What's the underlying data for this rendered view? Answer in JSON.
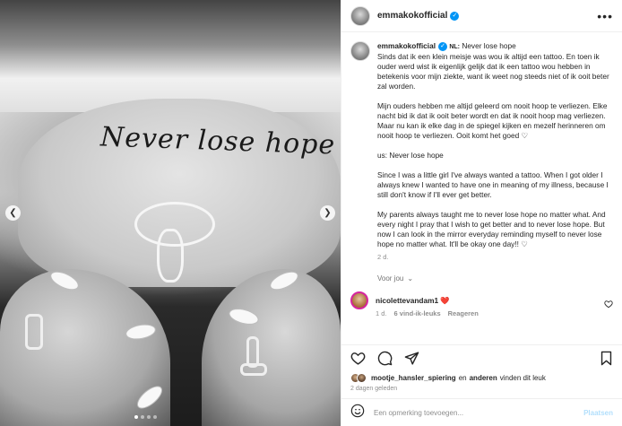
{
  "photo": {
    "tattoo_text": "Never lose hope",
    "prev_icon": "chevron-left-icon",
    "next_icon": "chevron-right-icon",
    "carousel_count": 4,
    "carousel_active": 1
  },
  "header": {
    "username": "emmakokofficial",
    "verified_icon": "verified-badge-icon",
    "more_icon": "more-horizontal-icon",
    "more_label": "•••"
  },
  "caption": {
    "username": "emmakokofficial",
    "lang_tag": "NL:",
    "lines": [
      "Never lose hope",
      "Sinds dat ik een klein meisje was wou ik altijd een tattoo. En toen ik ouder werd wist ik eigenlijk gelijk dat ik een tattoo wou hebben in betekenis voor mijn ziekte, want ik weet nog steeds niet of ik ooit beter zal worden.",
      "Mijn ouders hebben me altijd geleerd om nooit hoop te verliezen. Elke nacht bid ik dat ik ooit beter wordt en dat ik nooit hoop mag verliezen. Maar nu kan ik elke dag in de spiegel kijken en mezelf herinneren om nooit hoop te verliezen. Ooit komt het goed ♡",
      "us: Never lose hope",
      "Since I was a little girl I've always wanted a tattoo. When I got older I always knew I wanted to have one in meaning of my illness, because I still don't know if I'll ever get better.",
      "My parents always taught me to never lose hope no matter what. And every night I pray that I wish to get better and to never lose hope. But now I can look in the mirror everyday reminding myself to never lose hope no matter what. It'll be okay one day!! ♡"
    ],
    "time": "2 d."
  },
  "voor_jou": {
    "label": "Voor jou",
    "icon": "chevron-down-icon"
  },
  "comment": {
    "username": "nicolettevandam1",
    "text": "❤️",
    "time": "1 d.",
    "likes": "6 vind-ik-leuks",
    "reply": "Reageren",
    "heart_icon": "heart-outline-icon"
  },
  "actions": {
    "like_icon": "heart-icon",
    "comment_icon": "comment-icon",
    "share_icon": "paper-plane-icon",
    "save_icon": "bookmark-icon"
  },
  "likes": {
    "user": "mootje_hansler_spiering",
    "suffix": "en",
    "others": "anderen",
    "tail": "vinden dit leuk"
  },
  "posted_ago": "2 dagen geleden",
  "add_comment": {
    "emoji_icon": "emoji-smile-icon",
    "placeholder": "Een opmerking toevoegen...",
    "post_label": "Plaatsen"
  },
  "colors": {
    "accent": "#0095f6",
    "text": "#262626",
    "muted": "#8e8e8e",
    "heart_red": "#ed4956"
  }
}
